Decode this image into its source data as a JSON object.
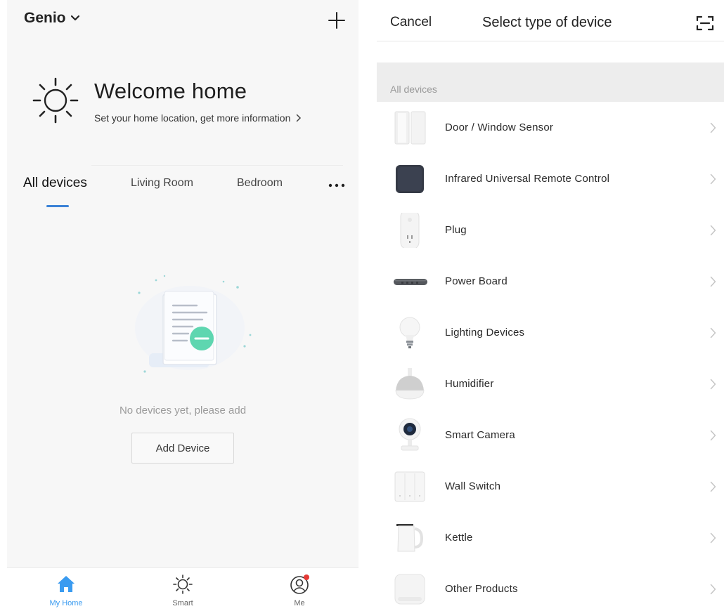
{
  "home": {
    "name": "Genio",
    "welcome_title": "Welcome home",
    "welcome_subtitle": "Set your home location, get more information",
    "tabs": [
      {
        "label": "All devices",
        "active": true
      },
      {
        "label": "Living Room",
        "active": false
      },
      {
        "label": "Bedroom",
        "active": false
      }
    ],
    "empty_message": "No devices yet, please add",
    "add_device_label": "Add Device",
    "nav": [
      {
        "label": "My Home",
        "icon": "house-icon",
        "active": true
      },
      {
        "label": "Smart",
        "icon": "sun-icon",
        "active": false
      },
      {
        "label": "Me",
        "icon": "profile-icon",
        "active": false,
        "badge": true
      }
    ]
  },
  "device_picker": {
    "cancel_label": "Cancel",
    "title": "Select type of device",
    "section_label": "All devices",
    "devices": [
      {
        "name": "Door / Window Sensor",
        "icon": "door-sensor-icon"
      },
      {
        "name": "Infrared Universal Remote Control",
        "icon": "ir-remote-icon"
      },
      {
        "name": "Plug",
        "icon": "plug-icon"
      },
      {
        "name": "Power Board",
        "icon": "power-board-icon"
      },
      {
        "name": "Lighting Devices",
        "icon": "bulb-icon"
      },
      {
        "name": "Humidifier",
        "icon": "humidifier-icon"
      },
      {
        "name": "Smart Camera",
        "icon": "camera-icon"
      },
      {
        "name": "Wall Switch",
        "icon": "wall-switch-icon"
      },
      {
        "name": "Kettle",
        "icon": "kettle-icon"
      },
      {
        "name": "Other Products",
        "icon": "other-products-icon"
      }
    ]
  },
  "colors": {
    "accent_blue": "#3a9bf0",
    "tab_underline": "#3b82d6",
    "badge_red": "#e53935",
    "illustration_green": "#5ed6b0"
  }
}
